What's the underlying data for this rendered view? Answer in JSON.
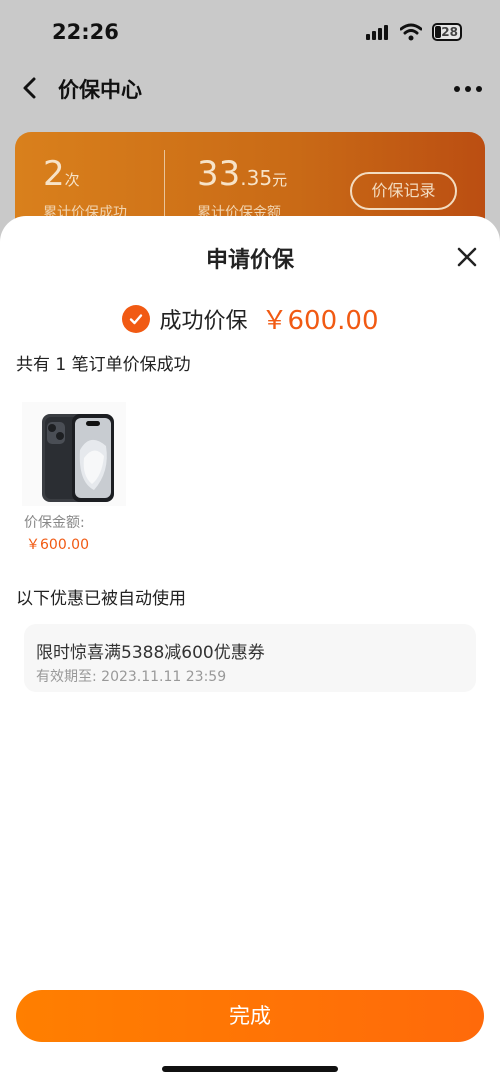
{
  "status_bar": {
    "time": "22:26",
    "battery": "28"
  },
  "nav": {
    "title": "价保中心"
  },
  "stats": {
    "count": "2",
    "count_unit": "次",
    "count_label": "累计价保成功",
    "amount_int": "33",
    "amount_dec": ".35",
    "amount_unit": "元",
    "amount_label": "累计价保金额",
    "record_button": "价保记录"
  },
  "sheet": {
    "title": "申请价保",
    "success_text": "成功价保",
    "success_amount": "￥600.00",
    "orders_line": "共有 1 笔订单价保成功",
    "product": {
      "protection_label": "价保金额:",
      "protection_value": "￥600.00"
    },
    "auto_line": "以下优惠已被自动使用",
    "coupon": {
      "title": "限时惊喜满5388减600优惠券",
      "expiry": "有效期至: 2023.11.11 23:59"
    },
    "done_button": "完成"
  },
  "colors": {
    "accent": "#f15a13",
    "button": "#ff7a05"
  },
  "icons": [
    "back-icon",
    "more-icon",
    "close-icon",
    "check-icon",
    "signal-icon",
    "wifi-icon",
    "battery-icon"
  ]
}
